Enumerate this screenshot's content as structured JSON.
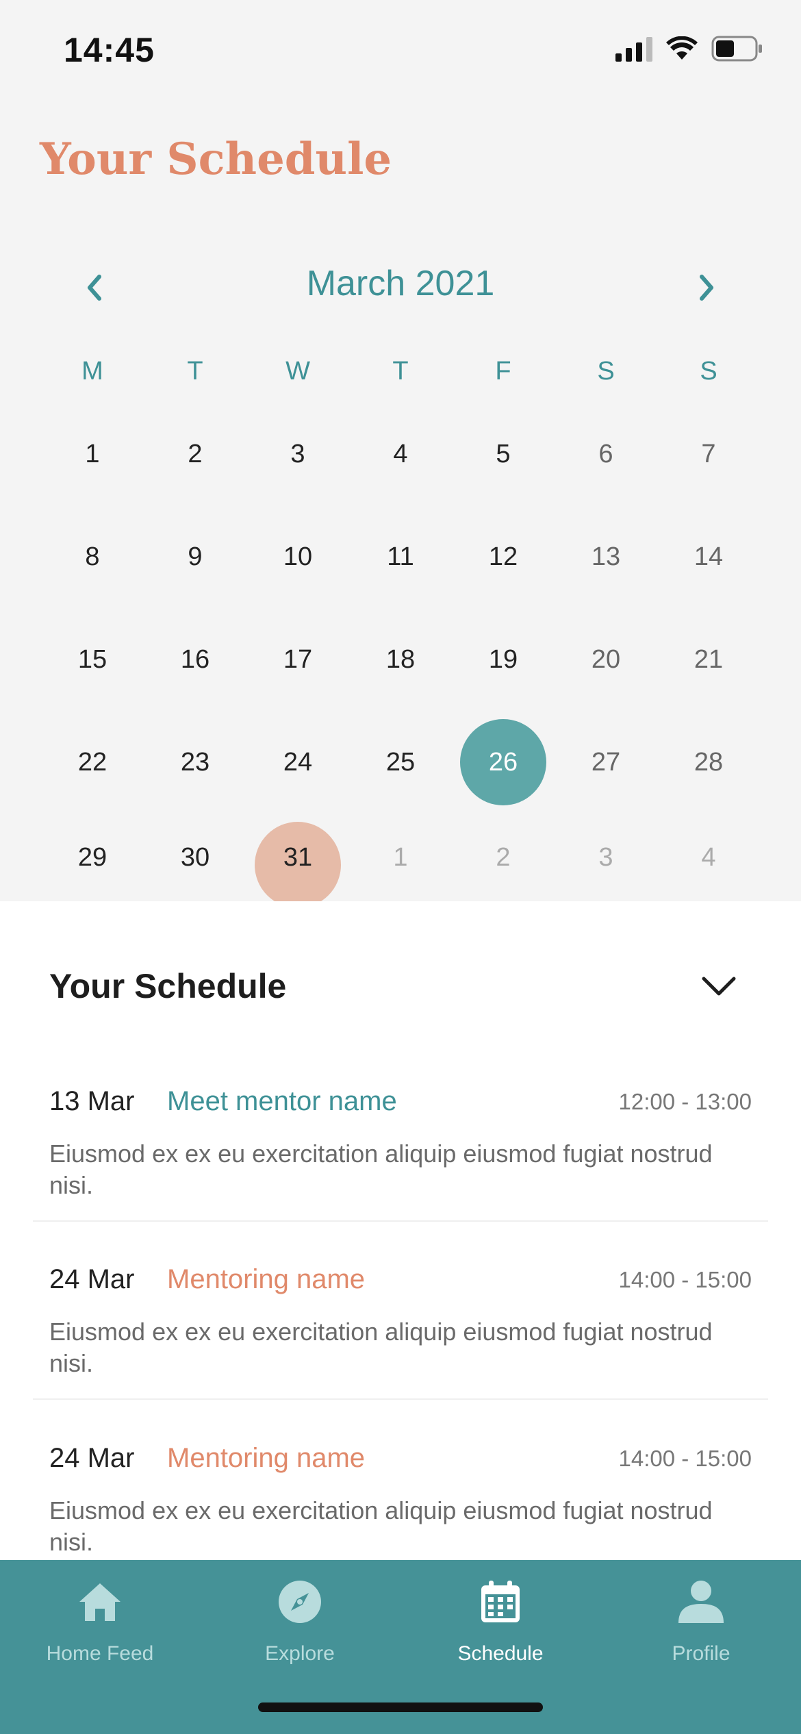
{
  "status_bar": {
    "time": "14:45"
  },
  "page_title": "Your Schedule",
  "calendar": {
    "month_label": "March 2021",
    "weekdays": [
      "M",
      "T",
      "W",
      "T",
      "F",
      "S",
      "S"
    ],
    "weeks": [
      [
        "1",
        "2",
        "3",
        "4",
        "5",
        "6",
        "7"
      ],
      [
        "8",
        "9",
        "10",
        "11",
        "12",
        "13",
        "14"
      ],
      [
        "15",
        "16",
        "17",
        "18",
        "19",
        "20",
        "21"
      ],
      [
        "22",
        "23",
        "24",
        "25",
        "26",
        "27",
        "28"
      ],
      [
        "29",
        "30",
        "31",
        "1",
        "2",
        "3",
        "4"
      ]
    ],
    "selected_day": "26",
    "today_day": "31",
    "colors": {
      "accent_teal": "#3e9196",
      "selected": "#5ea7a8",
      "today": "#e6bba8",
      "title_orange": "#e0896a"
    }
  },
  "schedule": {
    "title": "Your Schedule",
    "events": [
      {
        "date": "13 Mar",
        "name": "Meet mentor name",
        "time": "12:00 - 13:00",
        "description": "Eiusmod ex ex eu exercitation aliquip eiusmod fugiat nostrud nisi.",
        "color": "teal"
      },
      {
        "date": "24 Mar",
        "name": "Mentoring name",
        "time": "14:00 - 15:00",
        "description": "Eiusmod ex ex eu exercitation aliquip eiusmod fugiat nostrud nisi.",
        "color": "orange"
      },
      {
        "date": "24 Mar",
        "name": "Mentoring name",
        "time": "14:00 - 15:00",
        "description": "Eiusmod ex ex eu exercitation aliquip eiusmod fugiat nostrud nisi.",
        "color": "orange"
      }
    ]
  },
  "tab_bar": {
    "tabs": [
      {
        "label": "Home Feed",
        "icon": "home-icon",
        "active": false
      },
      {
        "label": "Explore",
        "icon": "compass-icon",
        "active": false
      },
      {
        "label": "Schedule",
        "icon": "calendar-icon",
        "active": true
      },
      {
        "label": "Profile",
        "icon": "person-icon",
        "active": false
      }
    ]
  }
}
